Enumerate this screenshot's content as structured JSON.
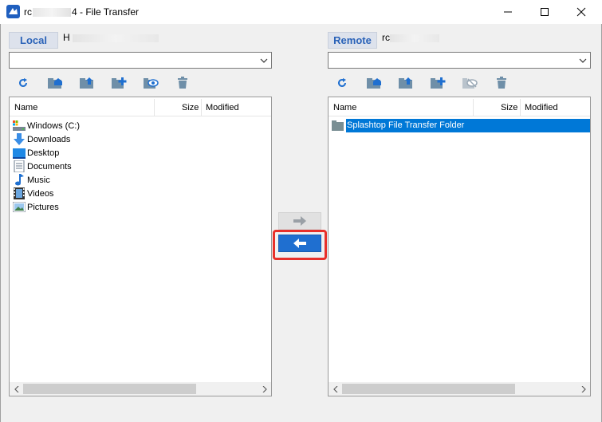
{
  "window": {
    "title_prefix": "rc",
    "title_suffix": "4 - File Transfer"
  },
  "local": {
    "tab_label": "Local",
    "host_prefix": "H",
    "path_value": "",
    "columns": {
      "name": "Name",
      "size": "Size",
      "modified": "Modified"
    },
    "items": [
      {
        "label": "Windows (C:)",
        "icon": "drive-icon"
      },
      {
        "label": "Downloads",
        "icon": "download-arrow-icon"
      },
      {
        "label": "Desktop",
        "icon": "desktop-icon"
      },
      {
        "label": "Documents",
        "icon": "document-icon"
      },
      {
        "label": "Music",
        "icon": "music-note-icon"
      },
      {
        "label": "Videos",
        "icon": "film-icon"
      },
      {
        "label": "Pictures",
        "icon": "picture-icon"
      }
    ]
  },
  "remote": {
    "tab_label": "Remote",
    "host_prefix": "rc",
    "path_value": "",
    "columns": {
      "name": "Name",
      "size": "Size",
      "modified": "Modified"
    },
    "items": [
      {
        "label": "Splashtop File Transfer Folder",
        "icon": "folder-icon",
        "selected": true
      }
    ]
  },
  "toolbar_icons": [
    "refresh-icon",
    "home-folder-icon",
    "parent-folder-icon",
    "new-folder-icon",
    "show-hidden-icon",
    "delete-icon"
  ],
  "colors": {
    "accent": "#0078d7",
    "tab_text": "#2b63b8",
    "transfer_active": "#1f6fd0",
    "highlight": "#e8302a"
  }
}
